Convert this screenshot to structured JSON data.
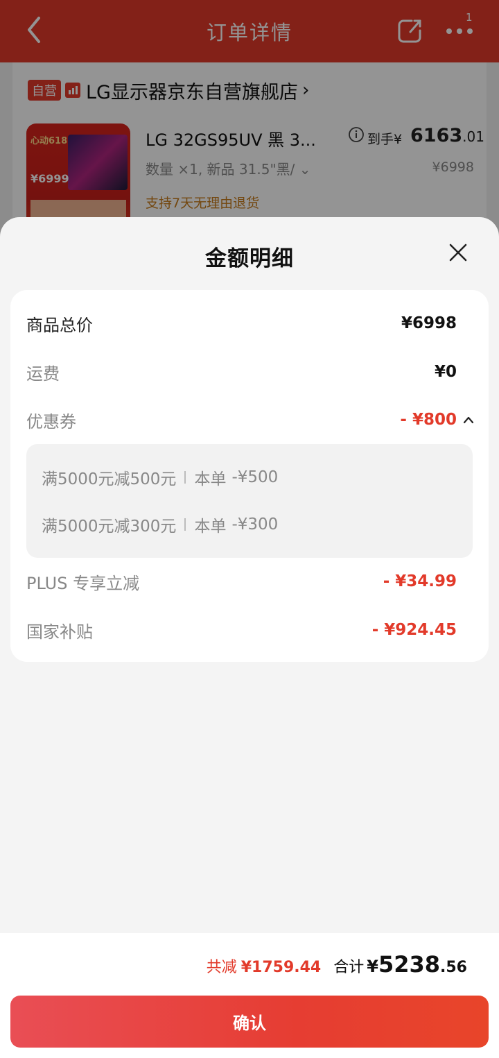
{
  "header": {
    "title": "订单详情",
    "badge": "1"
  },
  "store": {
    "self_tag": "自营",
    "name": "LG显示器京东自营旗舰店",
    "arrow": "›"
  },
  "product": {
    "title": "LG 32GS95UV 黑 3...",
    "spec": "数量 ×1, 新品 31.5\"黑/ ⌄",
    "price_label": "到手¥",
    "price_int": "6163",
    "price_dec": ".01",
    "original_price": "¥6998",
    "return_policy": "支持7天无理由退货",
    "thumb_text_1": "心动618",
    "thumb_text_2": "¥6999"
  },
  "sheet": {
    "title": "金额明细",
    "rows": {
      "subtotal": {
        "label": "商品总价",
        "value": "¥6998"
      },
      "shipping": {
        "label": "运费",
        "value": "¥0"
      },
      "coupon": {
        "label": "优惠券",
        "value": "- ¥800"
      },
      "plus": {
        "label": "PLUS 专享立减",
        "value": "- ¥34.99"
      },
      "subsidy": {
        "label": "国家补贴",
        "value": "- ¥924.45"
      }
    },
    "coupons": [
      {
        "desc": "满5000元减500元",
        "scope": "本单",
        "amount": "-¥500"
      },
      {
        "desc": "满5000元减300元",
        "scope": "本单",
        "amount": "-¥300"
      }
    ]
  },
  "footer": {
    "saved_label": "共减",
    "saved_value": "¥1759.44",
    "total_label": "合计",
    "total_yen": "¥",
    "total_int": "5238",
    "total_dec": ".56",
    "confirm_label": "确认"
  },
  "colors": {
    "accent": "#e23a2a",
    "sheet_bg": "#f4f4f4",
    "return_text": "#c77a1a"
  }
}
